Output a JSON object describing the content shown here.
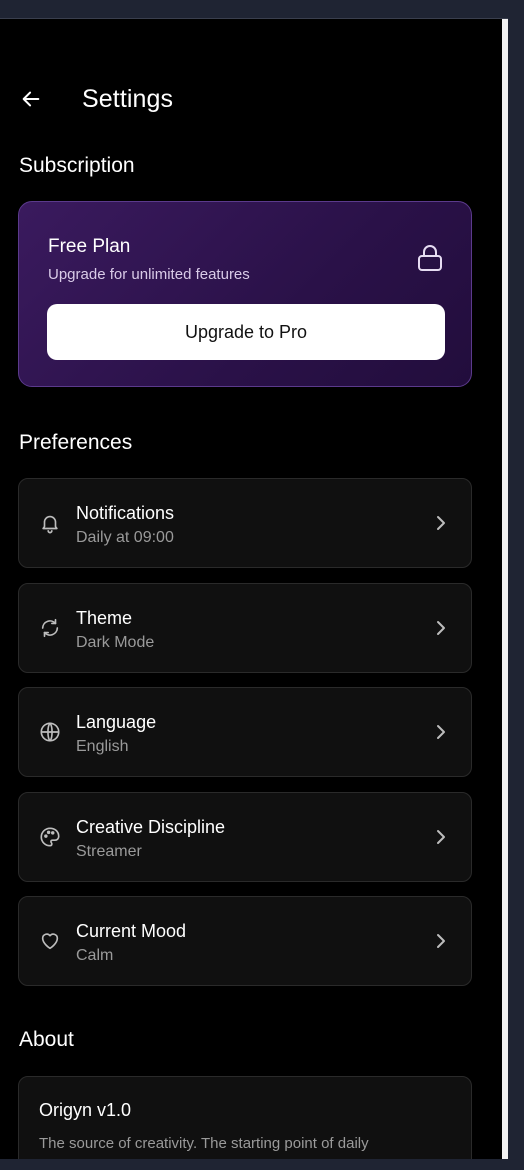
{
  "header": {
    "title": "Settings",
    "back_icon": "arrow-left-icon"
  },
  "subscription": {
    "section_title": "Subscription",
    "plan_name": "Free Plan",
    "plan_subtitle": "Upgrade for unlimited features",
    "lock_icon": "lock-icon",
    "upgrade_label": "Upgrade to Pro",
    "accent_color": "#3a1a5e"
  },
  "preferences": {
    "section_title": "Preferences",
    "items": [
      {
        "label": "Notifications",
        "value": "Daily at 09:00",
        "icon": "bell-icon"
      },
      {
        "label": "Theme",
        "value": "Dark Mode",
        "icon": "refresh-icon"
      },
      {
        "label": "Language",
        "value": "English",
        "icon": "globe-icon"
      },
      {
        "label": "Creative Discipline",
        "value": "Streamer",
        "icon": "palette-icon"
      },
      {
        "label": "Current Mood",
        "value": "Calm",
        "icon": "heart-icon"
      }
    ]
  },
  "about": {
    "section_title": "About",
    "app_name": "Origyn v1.0",
    "description": "The source of creativity. The starting point of daily"
  }
}
